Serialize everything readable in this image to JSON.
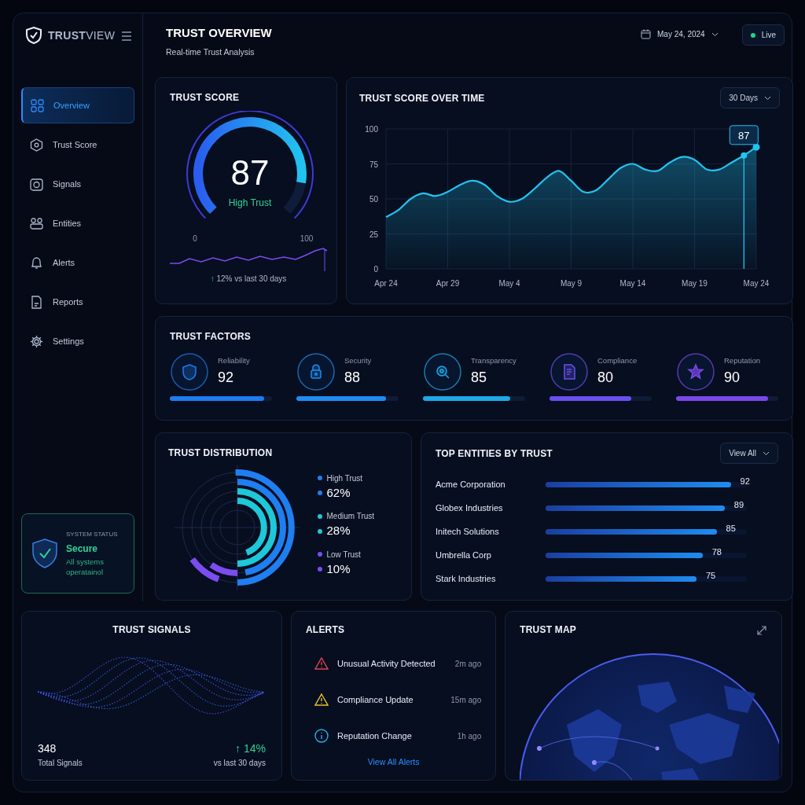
{
  "brand": {
    "name": "**TRUST**VIEW"
  },
  "sidebar": {
    "items": [
      {
        "label": "Overview",
        "selected": true
      },
      {
        "label": "Trust Score",
        "selected": false
      },
      {
        "label": "Signals",
        "selected": false
      },
      {
        "label": "Entities",
        "selected": false
      },
      {
        "label": "Alerts",
        "selected": false
      },
      {
        "label": "Reports",
        "selected": false
      },
      {
        "label": "Settings",
        "selected": false
      }
    ],
    "system_status": {
      "label": "SYSTEM STATUS",
      "status": "Secure",
      "message": "All systems operatainol"
    }
  },
  "header": {
    "title": "TRUST OVERVIEW",
    "subtitle": "Real-time Trust Analysis",
    "date": "May 24, 2024",
    "live": "Live"
  },
  "trust_score": {
    "title": "TRUST SCORE",
    "value": "87",
    "rating": "High Trust",
    "min": "0",
    "max": "100",
    "change_arrow": "↑",
    "change": "12% vs last 30 days"
  },
  "score_over_time": {
    "title": "TRUST SCORE OVER TIME",
    "range": "30 Days",
    "chart_data": {
      "type": "area",
      "categories": [
        "Apr 24",
        null,
        null,
        null,
        null,
        "Apr 29",
        null,
        null,
        null,
        null,
        "May 4",
        null,
        null,
        null,
        null,
        "May 9",
        null,
        null,
        null,
        null,
        "May 14",
        null,
        null,
        null,
        null,
        "May 19",
        null,
        null,
        null,
        null,
        "May 24"
      ],
      "series": [
        {
          "color": "#22c3f0",
          "values": [
            37,
            42,
            50,
            54,
            52,
            55,
            60,
            63,
            60,
            52,
            48,
            50,
            57,
            65,
            70,
            63,
            55,
            56,
            64,
            72,
            75,
            71,
            70,
            76,
            80,
            78,
            71,
            71,
            76,
            81,
            87
          ]
        }
      ],
      "ylim": [
        0,
        100
      ],
      "yticks": [
        0,
        25,
        50,
        75,
        100
      ],
      "grid": true,
      "annotations": [
        {
          "text": "87"
        }
      ]
    }
  },
  "trust_factors": {
    "title": "TRUST FACTORS",
    "items": [
      {
        "name": "Reliability",
        "value": "92",
        "level": 0.92,
        "color": "#1e7bf0"
      },
      {
        "name": "Security",
        "value": "88",
        "level": 0.88,
        "color": "#1e8cf0"
      },
      {
        "name": "Transparency",
        "value": "85",
        "level": 0.85,
        "color": "#1ea8e8"
      },
      {
        "name": "Compliance",
        "value": "80",
        "level": 0.8,
        "color": "#6a4ff0"
      },
      {
        "name": "Reputation",
        "value": "90",
        "level": 0.9,
        "color": "#7a48ea"
      }
    ]
  },
  "trust_distribution": {
    "title": "TRUST DISTRIBUTION",
    "items": [
      {
        "label": "High Trust",
        "value": "62%",
        "color": "#1f7ef0"
      },
      {
        "label": "Medium Trust",
        "value": "28%",
        "color": "#1ec8d8"
      },
      {
        "label": "Low Trust",
        "value": "10%",
        "color": "#7b4cf0"
      }
    ]
  },
  "top_entities": {
    "title": "TOP ENTITIES BY TRUST",
    "action": "View All",
    "items": [
      {
        "name": "Acme Corporation",
        "score": "92",
        "level": 0.92
      },
      {
        "name": "Globex Industries",
        "score": "89",
        "level": 0.89
      },
      {
        "name": "Initech Solutions",
        "score": "85",
        "level": 0.85
      },
      {
        "name": "Umbrella Corp",
        "score": "78",
        "level": 0.78
      },
      {
        "name": "Stark Industries",
        "score": "75",
        "level": 0.75
      }
    ]
  },
  "trust_signals": {
    "title": "TRUST SIGNALS",
    "count": "348",
    "count_label": "Total Signals",
    "change": "↑ 14%",
    "change_label": "vs last 30 days"
  },
  "alerts": {
    "title": "ALERTS",
    "items": [
      {
        "kind": "error",
        "text": "Unusual Activity Detected",
        "time": "2m ago"
      },
      {
        "kind": "warning",
        "text": "Compliance Update",
        "time": "15m ago"
      },
      {
        "kind": "info",
        "text": "Reputation Change",
        "time": "1h ago"
      }
    ],
    "link": "View All Alerts"
  },
  "trust_map": {
    "title": "TRUST MAP"
  }
}
